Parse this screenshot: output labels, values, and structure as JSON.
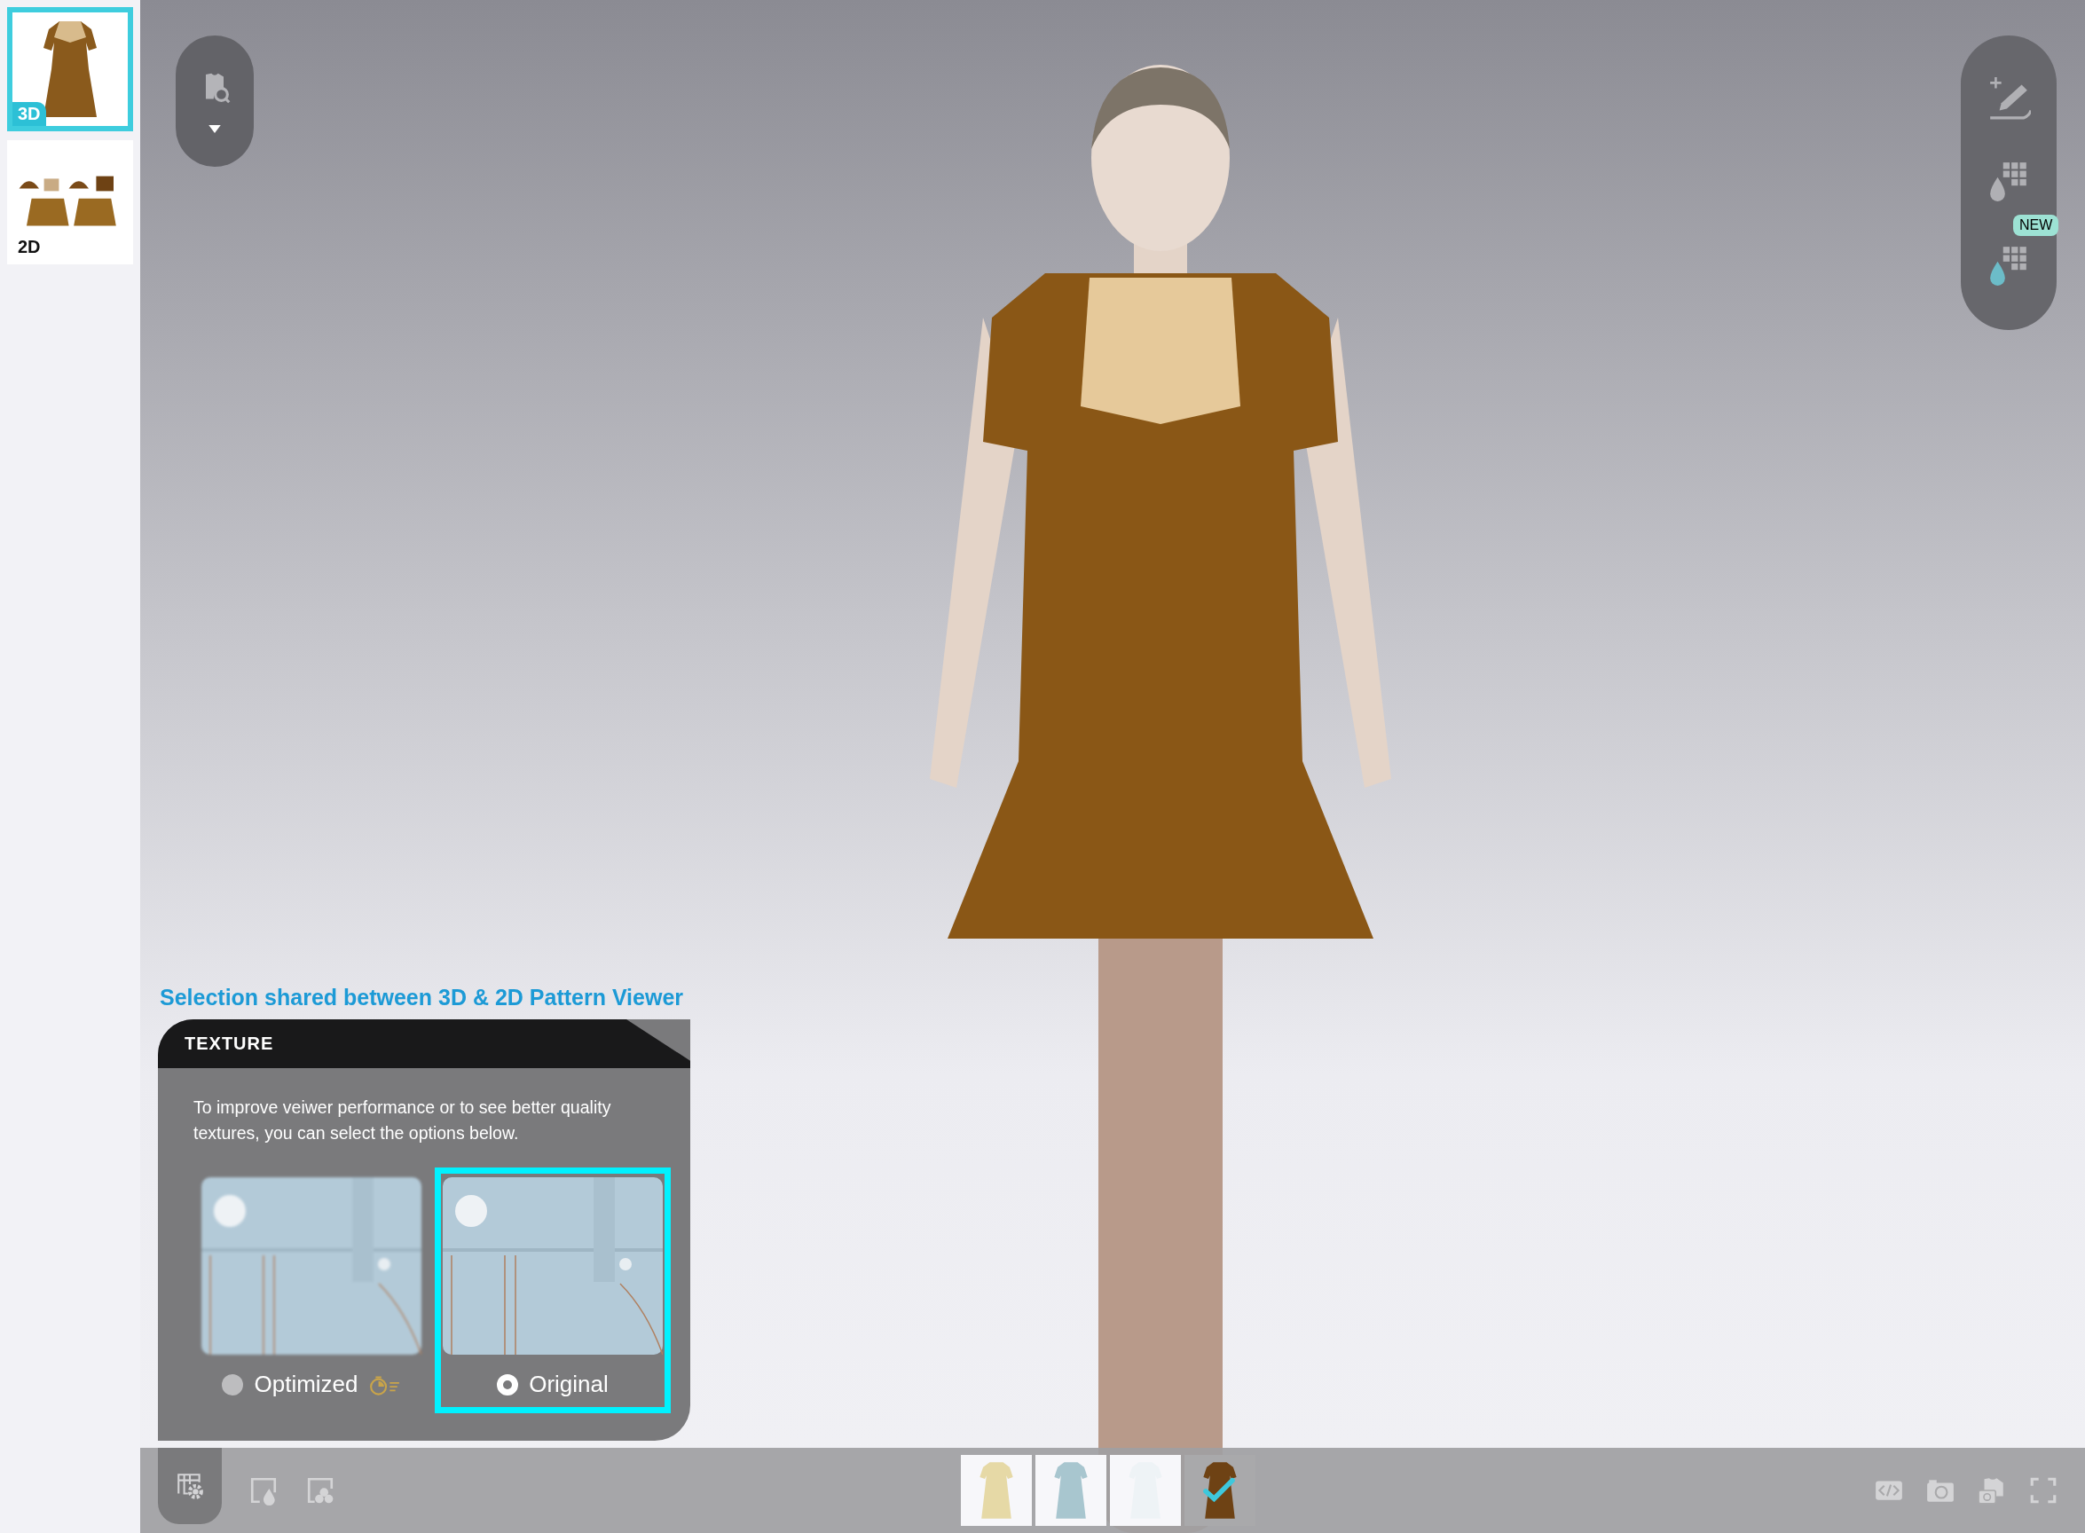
{
  "sidebar": {
    "views": [
      {
        "label": "3D",
        "selected": true
      },
      {
        "label": "2D",
        "selected": false
      }
    ]
  },
  "right_toolbar": {
    "badge": "NEW"
  },
  "texture_panel": {
    "hint": "Selection shared between 3D & 2D Pattern Viewer",
    "title": "TEXTURE",
    "description": "To improve veiwer performance or to see better quality textures, you can select the options below.",
    "options": [
      {
        "kind": "optimized",
        "label": "Optimized",
        "selected": false
      },
      {
        "kind": "original",
        "label": "Original",
        "selected": true
      }
    ]
  },
  "colorways": [
    {
      "color": "#e6d9a6",
      "selected": false
    },
    {
      "color": "#a8c6cf",
      "selected": false
    },
    {
      "color": "#eef3f6",
      "selected": false
    },
    {
      "color": "#6e4214",
      "selected": true
    }
  ]
}
